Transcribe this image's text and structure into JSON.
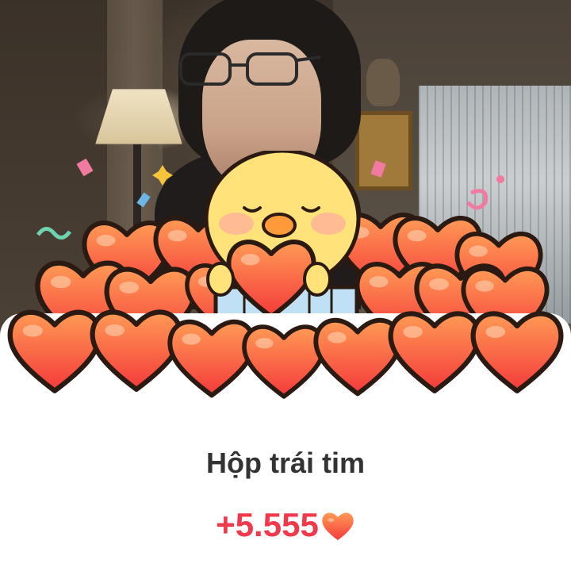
{
  "title": "Hộp trái tim",
  "amount": "+5.555",
  "amount_icon": "heart-icon",
  "colors": {
    "amount_red": "#f0394a",
    "title_gray": "#333333",
    "heart_fill_top": "#ff8a4c",
    "heart_fill_bottom": "#f43a3a",
    "heart_outline": "#2b1a12",
    "chick_yellow": "#ffe27a",
    "box_blue": "#bfe0f5"
  },
  "decorations": [
    "camera-background",
    "confetti",
    "chick-mascot",
    "heart-pile",
    "gift-box"
  ]
}
